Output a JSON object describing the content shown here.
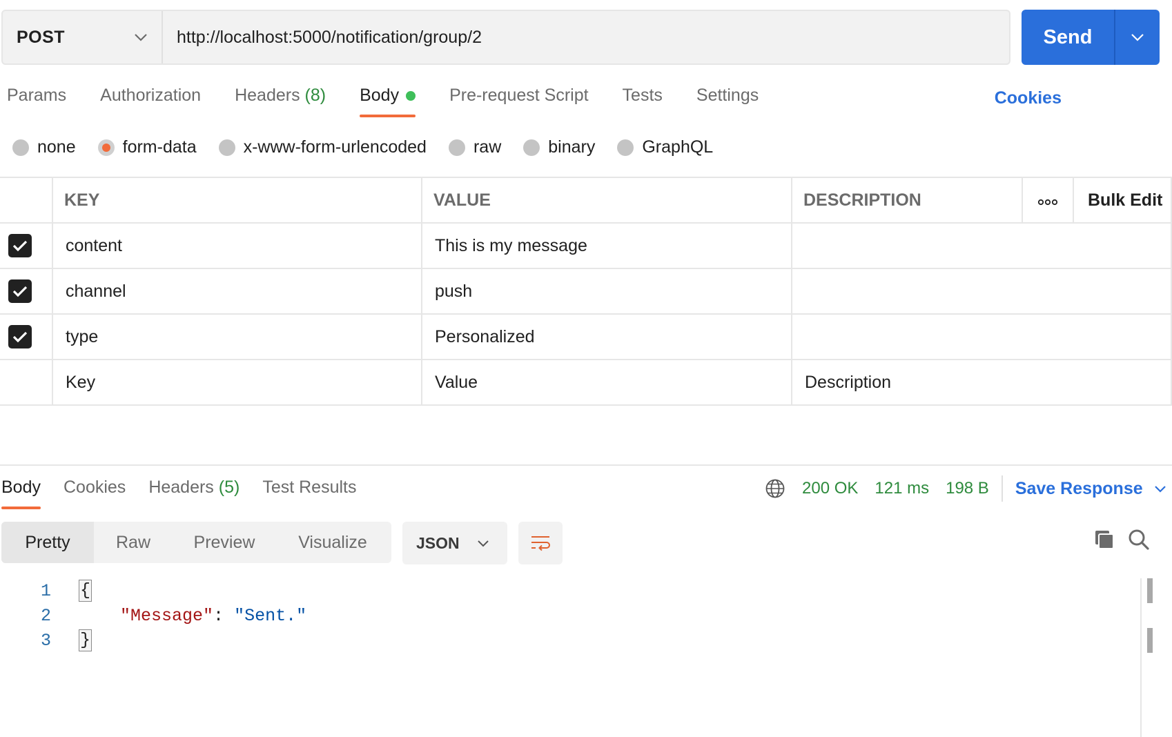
{
  "request": {
    "method": "POST",
    "url": "http://localhost:5000/notification/group/2",
    "send_label": "Send"
  },
  "tabs": {
    "params": "Params",
    "authorization": "Authorization",
    "headers": "Headers",
    "headers_count": "(8)",
    "body": "Body",
    "prerequest": "Pre-request Script",
    "tests": "Tests",
    "settings": "Settings",
    "cookies": "Cookies"
  },
  "body_types": {
    "none": "none",
    "form_data": "form-data",
    "urlencoded": "x-www-form-urlencoded",
    "raw": "raw",
    "binary": "binary",
    "graphql": "GraphQL",
    "selected": "form-data"
  },
  "form_table": {
    "headers": {
      "key": "KEY",
      "value": "VALUE",
      "description": "DESCRIPTION",
      "bulk_edit": "Bulk Edit"
    },
    "rows": [
      {
        "key": "content",
        "value": "This is my message",
        "description": ""
      },
      {
        "key": "channel",
        "value": "push",
        "description": ""
      },
      {
        "key": "type",
        "value": "Personalized",
        "description": ""
      }
    ],
    "placeholders": {
      "key": "Key",
      "value": "Value",
      "description": "Description"
    }
  },
  "response": {
    "tabs": {
      "body": "Body",
      "cookies": "Cookies",
      "headers": "Headers",
      "headers_count": "(5)",
      "test_results": "Test Results"
    },
    "status": "200 OK",
    "time": "121 ms",
    "size": "198 B",
    "save_label": "Save Response",
    "views": {
      "pretty": "Pretty",
      "raw": "Raw",
      "preview": "Preview",
      "visualize": "Visualize"
    },
    "format": "JSON",
    "code": {
      "line_numbers": [
        "1",
        "2",
        "3"
      ],
      "open_brace": "{",
      "key": "\"Message\"",
      "colon": ": ",
      "value": "\"Sent.\"",
      "close_brace": "}"
    }
  },
  "colors": {
    "accent": "#2a6fdb",
    "active_tab_underline": "#f26b3a",
    "status_green": "#2e8b3d",
    "body_dot": "#3fbf5a"
  }
}
